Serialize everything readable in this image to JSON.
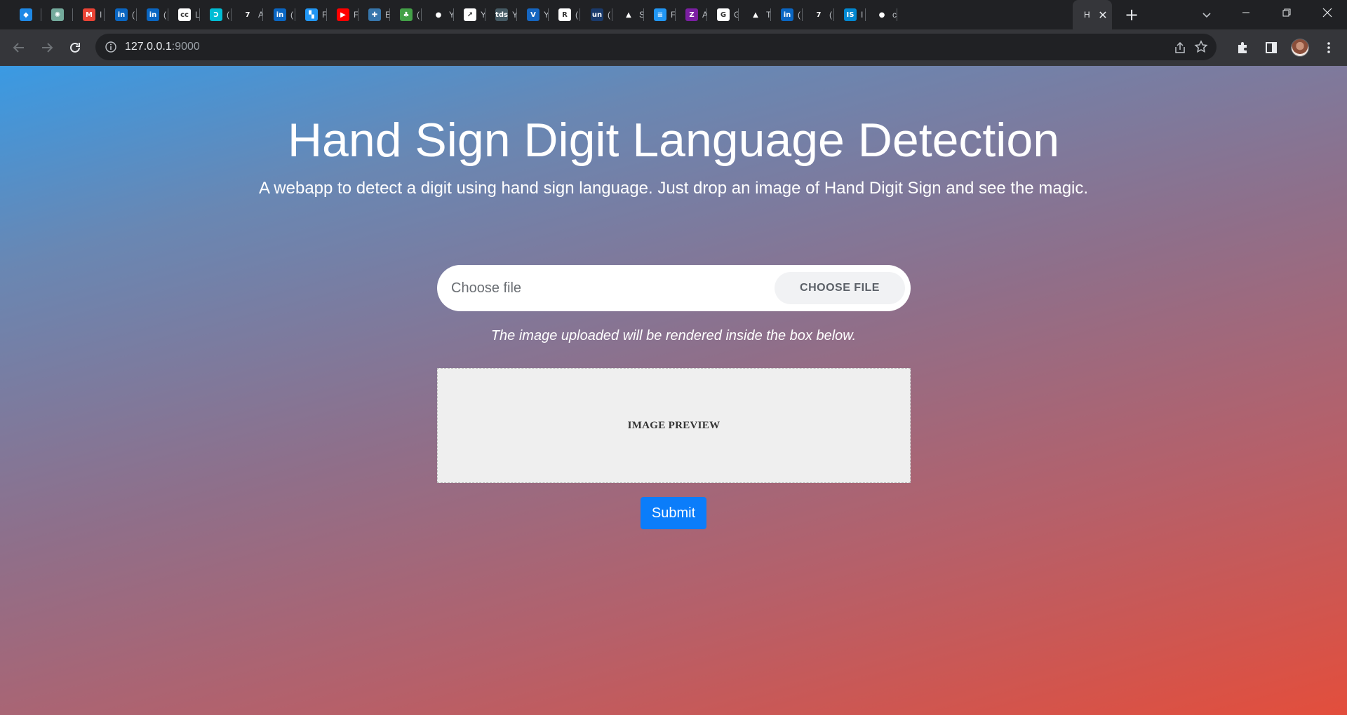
{
  "browser": {
    "tabs": [
      {
        "icon": "gem-icon",
        "color": "#1e88e5",
        "glyph": "◆",
        "title": ""
      },
      {
        "icon": "openai-icon",
        "color": "#74aa9c",
        "glyph": "✺",
        "title": ""
      },
      {
        "icon": "gmail-icon",
        "color": "#ea4335",
        "glyph": "M",
        "title": "I"
      },
      {
        "icon": "linkedin-icon",
        "color": "#0a66c2",
        "glyph": "in",
        "title": "("
      },
      {
        "icon": "linkedin-icon",
        "color": "#0a66c2",
        "glyph": "in",
        "title": "("
      },
      {
        "icon": "cisco-icon",
        "color": "#ffffff",
        "glyph": "cc",
        "title": "L"
      },
      {
        "icon": "swirl-icon",
        "color": "#00bcd4",
        "glyph": "Ↄ",
        "title": "("
      },
      {
        "icon": "z-icon",
        "color": "#202124",
        "glyph": "7",
        "title": "A"
      },
      {
        "icon": "linkedin-icon",
        "color": "#0a66c2",
        "glyph": "in",
        "title": "("
      },
      {
        "icon": "stack-icon",
        "color": "#2196f3",
        "glyph": "▚",
        "title": "F"
      },
      {
        "icon": "youtube-icon",
        "color": "#ff0000",
        "glyph": "▶",
        "title": "F"
      },
      {
        "icon": "python-icon",
        "color": "#3776ab",
        "glyph": "✚",
        "title": "E"
      },
      {
        "icon": "tree-icon",
        "color": "#43a047",
        "glyph": "♣",
        "title": "("
      },
      {
        "icon": "github-icon",
        "color": "#202124",
        "glyph": "●",
        "title": "Y"
      },
      {
        "icon": "chart-icon",
        "color": "#ffffff",
        "glyph": "↗",
        "title": "Y"
      },
      {
        "icon": "tds-icon",
        "color": "#455a64",
        "glyph": "tds",
        "title": "Y"
      },
      {
        "icon": "v-icon",
        "color": "#1565c0",
        "glyph": "V",
        "title": "Y"
      },
      {
        "icon": "r6-icon",
        "color": "#ffffff",
        "glyph": "R",
        "title": "("
      },
      {
        "icon": "un-icon",
        "color": "#1a3a6b",
        "glyph": "un",
        "title": "("
      },
      {
        "icon": "mountain-icon",
        "color": "#202124",
        "glyph": "▲",
        "title": "S"
      },
      {
        "icon": "doc-icon",
        "color": "#2196f3",
        "glyph": "≡",
        "title": "F"
      },
      {
        "icon": "z-circle-icon",
        "color": "#7b1fa2",
        "glyph": "Z",
        "title": "A"
      },
      {
        "icon": "google-icon",
        "color": "#ffffff",
        "glyph": "G",
        "title": "G"
      },
      {
        "icon": "mountain-icon",
        "color": "#202124",
        "glyph": "▲",
        "title": "T"
      },
      {
        "icon": "linkedin-icon",
        "color": "#0a66c2",
        "glyph": "in",
        "title": "("
      },
      {
        "icon": "z-icon",
        "color": "#202124",
        "glyph": "7",
        "title": "("
      },
      {
        "icon": "is-icon",
        "color": "#0288d1",
        "glyph": "IS",
        "title": "I"
      },
      {
        "icon": "github-icon",
        "color": "#202124",
        "glyph": "●",
        "title": "c"
      }
    ],
    "active_tab": {
      "title": "H",
      "close": "✕"
    },
    "new_tab_glyph": "+",
    "url_host": "127.0.0.1",
    "url_port": ":9000"
  },
  "page": {
    "title": "Hand Sign Digit Language Detection",
    "subtitle": "A webapp to detect a digit using hand sign language. Just drop an image of Hand Digit Sign and see the magic.",
    "file_placeholder": "Choose file",
    "choose_file_label": "CHOOSE FILE",
    "hint": "The image uploaded will be rendered inside the box below.",
    "preview_label": "IMAGE PREVIEW",
    "submit_label": "Submit"
  },
  "colors": {
    "gradient_start": "#3a9ae3",
    "gradient_end": "#e34e3c",
    "submit": "#0b7dfa"
  }
}
